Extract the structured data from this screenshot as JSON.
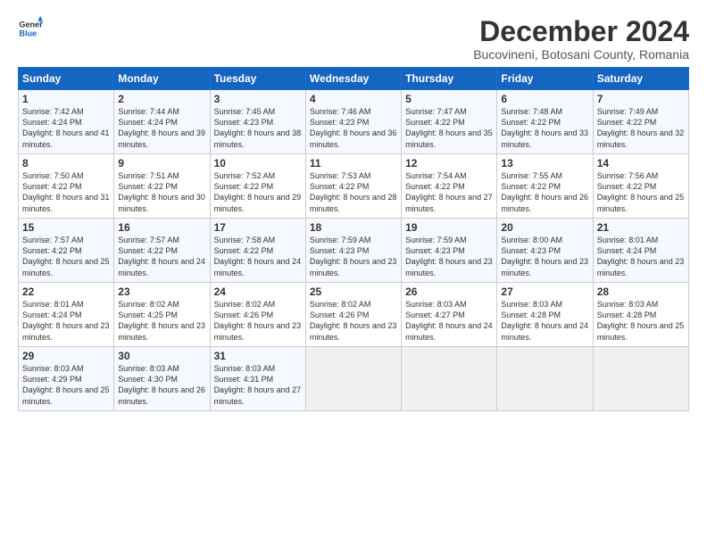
{
  "logo": {
    "line1": "General",
    "line2": "Blue"
  },
  "title": "December 2024",
  "subtitle": "Bucovineni, Botosani County, Romania",
  "days_header": [
    "Sunday",
    "Monday",
    "Tuesday",
    "Wednesday",
    "Thursday",
    "Friday",
    "Saturday"
  ],
  "weeks": [
    [
      {
        "day": "1",
        "sunrise": "7:42 AM",
        "sunset": "4:24 PM",
        "daylight": "8 hours and 41 minutes."
      },
      {
        "day": "2",
        "sunrise": "7:44 AM",
        "sunset": "4:24 PM",
        "daylight": "8 hours and 39 minutes."
      },
      {
        "day": "3",
        "sunrise": "7:45 AM",
        "sunset": "4:23 PM",
        "daylight": "8 hours and 38 minutes."
      },
      {
        "day": "4",
        "sunrise": "7:46 AM",
        "sunset": "4:23 PM",
        "daylight": "8 hours and 36 minutes."
      },
      {
        "day": "5",
        "sunrise": "7:47 AM",
        "sunset": "4:22 PM",
        "daylight": "8 hours and 35 minutes."
      },
      {
        "day": "6",
        "sunrise": "7:48 AM",
        "sunset": "4:22 PM",
        "daylight": "8 hours and 33 minutes."
      },
      {
        "day": "7",
        "sunrise": "7:49 AM",
        "sunset": "4:22 PM",
        "daylight": "8 hours and 32 minutes."
      }
    ],
    [
      {
        "day": "8",
        "sunrise": "7:50 AM",
        "sunset": "4:22 PM",
        "daylight": "8 hours and 31 minutes."
      },
      {
        "day": "9",
        "sunrise": "7:51 AM",
        "sunset": "4:22 PM",
        "daylight": "8 hours and 30 minutes."
      },
      {
        "day": "10",
        "sunrise": "7:52 AM",
        "sunset": "4:22 PM",
        "daylight": "8 hours and 29 minutes."
      },
      {
        "day": "11",
        "sunrise": "7:53 AM",
        "sunset": "4:22 PM",
        "daylight": "8 hours and 28 minutes."
      },
      {
        "day": "12",
        "sunrise": "7:54 AM",
        "sunset": "4:22 PM",
        "daylight": "8 hours and 27 minutes."
      },
      {
        "day": "13",
        "sunrise": "7:55 AM",
        "sunset": "4:22 PM",
        "daylight": "8 hours and 26 minutes."
      },
      {
        "day": "14",
        "sunrise": "7:56 AM",
        "sunset": "4:22 PM",
        "daylight": "8 hours and 25 minutes."
      }
    ],
    [
      {
        "day": "15",
        "sunrise": "7:57 AM",
        "sunset": "4:22 PM",
        "daylight": "8 hours and 25 minutes."
      },
      {
        "day": "16",
        "sunrise": "7:57 AM",
        "sunset": "4:22 PM",
        "daylight": "8 hours and 24 minutes."
      },
      {
        "day": "17",
        "sunrise": "7:58 AM",
        "sunset": "4:22 PM",
        "daylight": "8 hours and 24 minutes."
      },
      {
        "day": "18",
        "sunrise": "7:59 AM",
        "sunset": "4:23 PM",
        "daylight": "8 hours and 23 minutes."
      },
      {
        "day": "19",
        "sunrise": "7:59 AM",
        "sunset": "4:23 PM",
        "daylight": "8 hours and 23 minutes."
      },
      {
        "day": "20",
        "sunrise": "8:00 AM",
        "sunset": "4:23 PM",
        "daylight": "8 hours and 23 minutes."
      },
      {
        "day": "21",
        "sunrise": "8:01 AM",
        "sunset": "4:24 PM",
        "daylight": "8 hours and 23 minutes."
      }
    ],
    [
      {
        "day": "22",
        "sunrise": "8:01 AM",
        "sunset": "4:24 PM",
        "daylight": "8 hours and 23 minutes."
      },
      {
        "day": "23",
        "sunrise": "8:02 AM",
        "sunset": "4:25 PM",
        "daylight": "8 hours and 23 minutes."
      },
      {
        "day": "24",
        "sunrise": "8:02 AM",
        "sunset": "4:26 PM",
        "daylight": "8 hours and 23 minutes."
      },
      {
        "day": "25",
        "sunrise": "8:02 AM",
        "sunset": "4:26 PM",
        "daylight": "8 hours and 23 minutes."
      },
      {
        "day": "26",
        "sunrise": "8:03 AM",
        "sunset": "4:27 PM",
        "daylight": "8 hours and 24 minutes."
      },
      {
        "day": "27",
        "sunrise": "8:03 AM",
        "sunset": "4:28 PM",
        "daylight": "8 hours and 24 minutes."
      },
      {
        "day": "28",
        "sunrise": "8:03 AM",
        "sunset": "4:28 PM",
        "daylight": "8 hours and 25 minutes."
      }
    ],
    [
      {
        "day": "29",
        "sunrise": "8:03 AM",
        "sunset": "4:29 PM",
        "daylight": "8 hours and 25 minutes."
      },
      {
        "day": "30",
        "sunrise": "8:03 AM",
        "sunset": "4:30 PM",
        "daylight": "8 hours and 26 minutes."
      },
      {
        "day": "31",
        "sunrise": "8:03 AM",
        "sunset": "4:31 PM",
        "daylight": "8 hours and 27 minutes."
      },
      null,
      null,
      null,
      null
    ]
  ]
}
